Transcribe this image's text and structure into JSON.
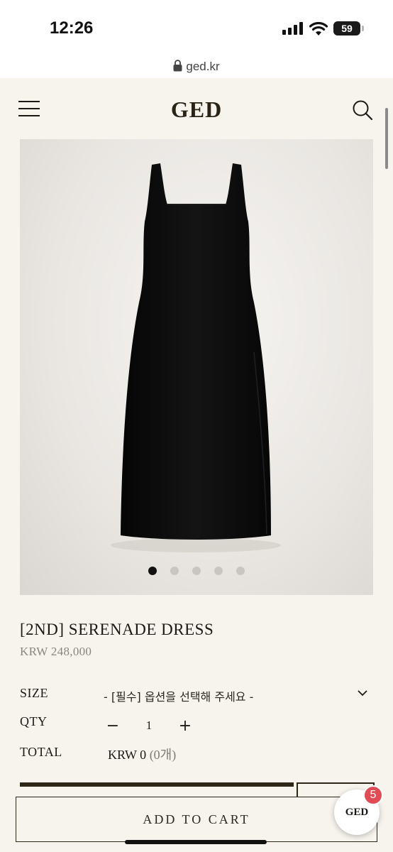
{
  "status_bar": {
    "time": "12:26",
    "battery": "59"
  },
  "browser": {
    "url": "ged.kr"
  },
  "header": {
    "logo": "GED"
  },
  "carousel": {
    "total": 5,
    "active_index": 0
  },
  "product": {
    "title": "[2ND] SERENADE DRESS",
    "price": "KRW 248,000"
  },
  "options": {
    "size_label": "SIZE",
    "size_placeholder": "- [필수] 옵션을 선택해 주세요 -",
    "qty_label": "QTY",
    "qty_minus": "−",
    "qty_value": "1",
    "qty_plus": "+",
    "total_label": "TOTAL",
    "total_amount": "KRW 0",
    "total_count": "(0개)"
  },
  "actions": {
    "add_to_cart": "ADD TO CART"
  },
  "chat": {
    "label": "GED",
    "badge": "5"
  },
  "colors": {
    "background": "#f7f4ee",
    "brand_dark": "#2e2616",
    "badge": "#e14b55"
  }
}
